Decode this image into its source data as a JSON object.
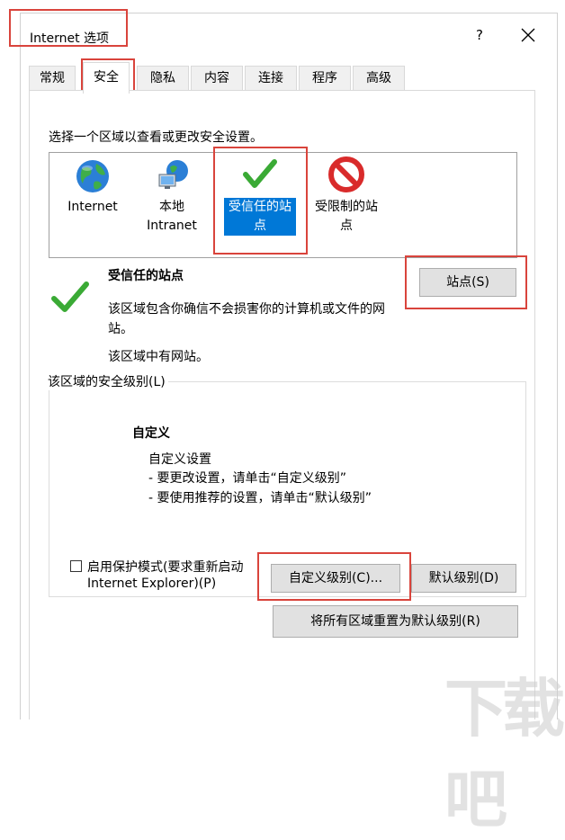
{
  "window": {
    "title": "Internet 选项",
    "help_label": "?",
    "close_label": "×"
  },
  "tabs": [
    {
      "label": "常规"
    },
    {
      "label": "安全"
    },
    {
      "label": "隐私"
    },
    {
      "label": "内容"
    },
    {
      "label": "连接"
    },
    {
      "label": "程序"
    },
    {
      "label": "高级"
    }
  ],
  "security": {
    "instruction": "选择一个区域以查看或更改安全设置。",
    "zones": [
      {
        "label_line1": "Internet",
        "label_line2": "",
        "icon": "globe-icon"
      },
      {
        "label_line1": "本地",
        "label_line2": "Intranet",
        "icon": "local-intranet-icon"
      },
      {
        "label_line1": "受信任的站",
        "label_line2": "点",
        "icon": "green-checkmark-icon"
      },
      {
        "label_line1": "受限制的站",
        "label_line2": "点",
        "icon": "restricted-icon"
      }
    ],
    "selected_zone": {
      "name": "受信任的站点",
      "description_line1": "该区域包含你确信不会损害你的计算机或文件的网",
      "description_line2": "站。",
      "status": "该区域中有网站。",
      "sites_button": "站点(S)"
    },
    "level_group": {
      "title": "该区域的安全级别(L)",
      "level_name": "自定义",
      "line1": "自定义设置",
      "line2": "- 要更改设置，请单击“自定义级别”",
      "line3": "- 要使用推荐的设置，请单击“默认级别”"
    },
    "protected_mode": {
      "label_line1": "启用保护模式(要求重新启动",
      "label_line2": "Internet Explorer)(P)",
      "checked": false
    },
    "custom_level_button": "自定义级别(C)...",
    "default_level_button": "默认级别(D)",
    "reset_all_button": "将所有区域重置为默认级别(R)"
  },
  "colors": {
    "highlight": "#0078d7",
    "annotation_red": "#d9443c",
    "check_green": "#3aaa35"
  }
}
